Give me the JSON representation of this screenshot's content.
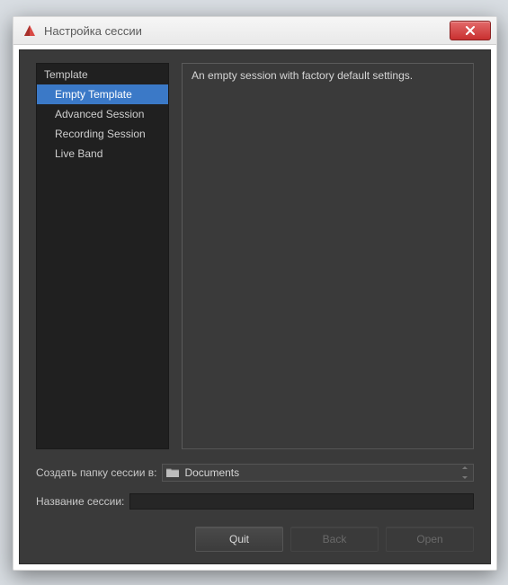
{
  "window": {
    "title": "Настройка сессии"
  },
  "tree": {
    "header": "Template",
    "items": [
      {
        "label": "Empty Template",
        "selected": true
      },
      {
        "label": "Advanced Session",
        "selected": false
      },
      {
        "label": "Recording Session",
        "selected": false
      },
      {
        "label": "Live Band",
        "selected": false
      }
    ]
  },
  "description": "An empty session with factory default settings.",
  "folder": {
    "label": "Создать папку сессии в:",
    "value": "Documents"
  },
  "session_name": {
    "label": "Название сессии:",
    "value": ""
  },
  "buttons": {
    "quit": "Quit",
    "back": "Back",
    "open": "Open"
  }
}
